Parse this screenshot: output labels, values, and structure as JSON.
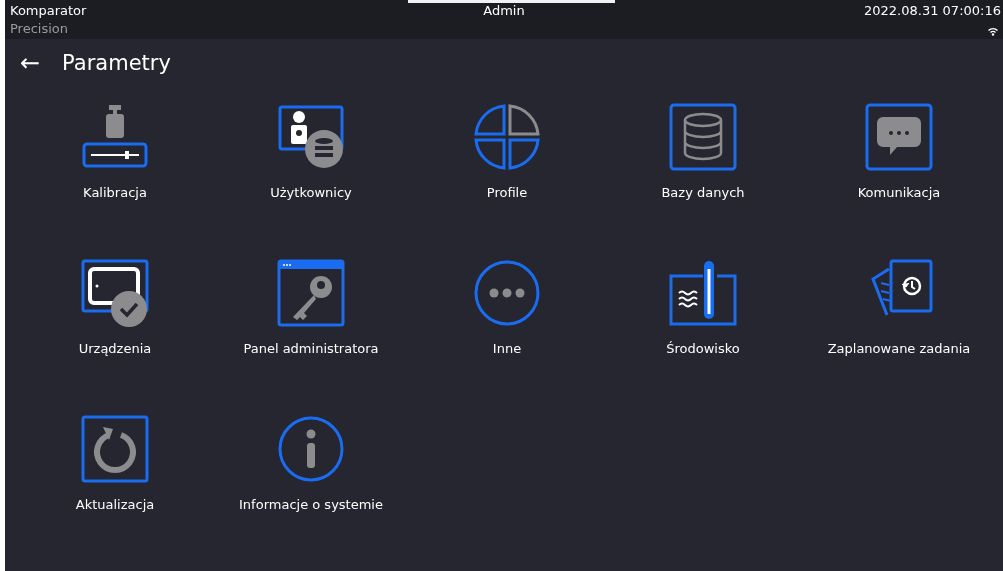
{
  "status_bar": {
    "mode": "Komparator",
    "user": "Admin",
    "datetime": "2022.08.31 07:00:16",
    "device": "Precision"
  },
  "header": {
    "back": "←",
    "title": "Parametry"
  },
  "items": [
    {
      "kind": "calibration",
      "label": "Kalibracja"
    },
    {
      "kind": "users",
      "label": "Użytkownicy"
    },
    {
      "kind": "profiles",
      "label": "Profile"
    },
    {
      "kind": "databases",
      "label": "Bazy danych"
    },
    {
      "kind": "communication",
      "label": "Komunikacja"
    },
    {
      "kind": "devices",
      "label": "Urządzenia"
    },
    {
      "kind": "admin",
      "label": "Panel administratora"
    },
    {
      "kind": "other",
      "label": "Inne"
    },
    {
      "kind": "environment",
      "label": "Środowisko"
    },
    {
      "kind": "scheduled",
      "label": "Zaplanowane zadania"
    },
    {
      "kind": "update",
      "label": "Aktualizacja"
    },
    {
      "kind": "info",
      "label": "Informacje o systemie"
    }
  ]
}
